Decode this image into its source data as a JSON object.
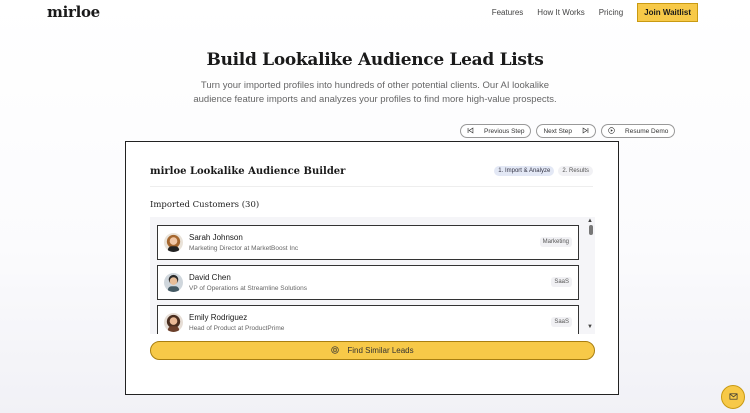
{
  "nav": {
    "logo": "mirloe",
    "links": [
      "Features",
      "How It Works",
      "Pricing"
    ],
    "cta": "Join Waitlist"
  },
  "hero": {
    "title": "Build Lookalike Audience Lead Lists",
    "subtitle": "Turn your imported profiles into hundreds of other potential clients. Our AI lookalike audience feature imports and analyzes your profiles to find more high-value prospects."
  },
  "controls": {
    "previous": "Previous Step",
    "next": "Next Step",
    "resume": "Resume Demo"
  },
  "card": {
    "title": "mirloe Lookalike Audience Builder",
    "steps": [
      "1. Import & Analyze",
      "2. Results"
    ],
    "active_step": 0,
    "section_title": "Imported Customers (30)",
    "customers": [
      {
        "name": "Sarah Johnson",
        "role": "Marketing Director at MarketBoost Inc",
        "tag": "Marketing"
      },
      {
        "name": "David Chen",
        "role": "VP of Operations at Streamline Solutions",
        "tag": "SaaS"
      },
      {
        "name": "Emily Rodriguez",
        "role": "Head of Product at ProductPrime",
        "tag": "SaaS"
      }
    ],
    "find_button": "Find Similar Leads"
  },
  "icons": {
    "previous": "skip-back-icon",
    "next": "skip-forward-icon",
    "resume": "play-circle-icon",
    "find": "target-icon",
    "chat": "mail-icon",
    "scroll_up": "caret-up-icon",
    "scroll_down": "caret-down-icon"
  },
  "colors": {
    "accent": "#f7c948",
    "accent_border": "#c99a12",
    "active_step_bg": "#e3e8f5"
  }
}
